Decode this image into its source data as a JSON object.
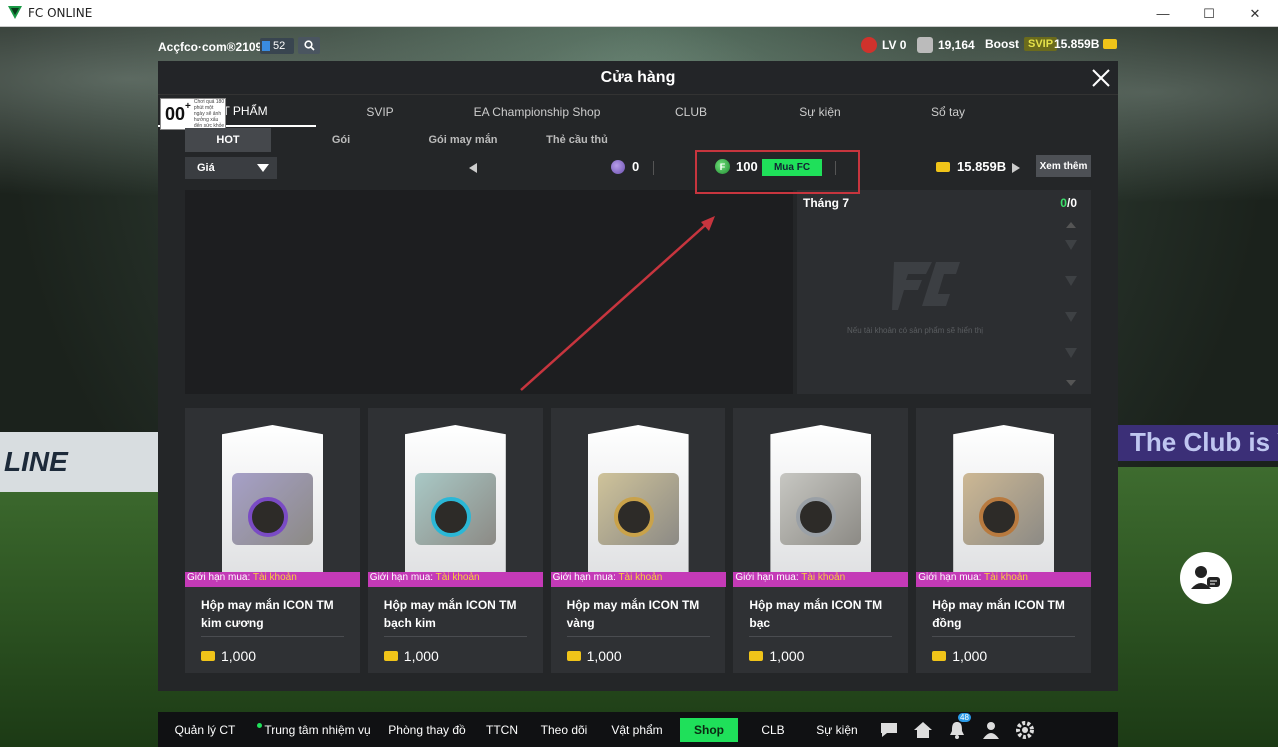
{
  "window": {
    "title": "FC ONLINE",
    "controls": [
      "minimize",
      "maximize",
      "close"
    ]
  },
  "background": {
    "ad_left": "LINE",
    "ad_right": "The Club is Y"
  },
  "topbar": {
    "username": "Acçfco·com®2109u",
    "level": "52",
    "lv": "LV 0",
    "points": "19,164",
    "boost": "Boost",
    "svip": "SVIP",
    "gold": "15.859B"
  },
  "store": {
    "title": "Cửa hàng",
    "badge": {
      "big": "00",
      "plus": "+",
      "small": "Chơi quá 180 phút một ngày sẽ ảnh hưởng xấu đến sức khỏe"
    },
    "main_tabs": [
      "VẬT PHẨM",
      "SVIP",
      "EA Championship Shop",
      "CLUB",
      "Sự kiện",
      "Sổ tay"
    ],
    "active_main_tab": 0,
    "sub_tabs": [
      "HOT",
      "Gói",
      "Gói may mắn",
      "Thẻ cầu thủ"
    ],
    "active_sub_tab": 0,
    "filter": {
      "price_label": "Giá",
      "purple_value": "0",
      "fc_value": "100",
      "buy_fc_label": "Mua FC",
      "gold_value": "15.859B",
      "more_label": "Xem thêm"
    },
    "calendar": {
      "month": "Tháng 7",
      "count_done": "0",
      "count_total": "/0",
      "empty_text": "Nếu tài khoản có sản phẩm sẽ hiển thị"
    },
    "limit_prefix": "Giới hạn mua:",
    "limit_value": "Tài khoản",
    "items": [
      {
        "name": "Hộp may mắn ICON TM kim cương",
        "price": "1,000",
        "ring": "#7a4bc4",
        "glow": "#a6a0c8"
      },
      {
        "name": "Hộp may mắn ICON TM bạch kim",
        "price": "1,000",
        "ring": "#2bb7d6",
        "glow": "#a9c9c6"
      },
      {
        "name": "Hộp may mắn ICON TM vàng",
        "price": "1,000",
        "ring": "#c9a24a",
        "glow": "#cfc39a"
      },
      {
        "name": "Hộp may mắn ICON TM bạc",
        "price": "1,000",
        "ring": "#9aa0a6",
        "glow": "#c7c7c2"
      },
      {
        "name": "Hộp may mắn ICON TM đồng",
        "price": "1,000",
        "ring": "#b87a3f",
        "glow": "#cdb894"
      }
    ]
  },
  "bottom_nav": {
    "items": [
      "Quản lý CT",
      "Trung tâm nhiệm vụ",
      "Phòng thay đồ",
      "TTCN",
      "Theo dõi",
      "Vật phẩm",
      "Shop",
      "CLB",
      "Sự kiện"
    ],
    "active": "Shop",
    "notif_count": "48",
    "icons": [
      "chat-icon",
      "home-icon",
      "bell-icon",
      "profile-icon",
      "settings-icon"
    ]
  },
  "colors": {
    "accent_green": "#1fe05a",
    "limit_pink": "#c43ab7",
    "highlight_red": "#c7353e"
  }
}
